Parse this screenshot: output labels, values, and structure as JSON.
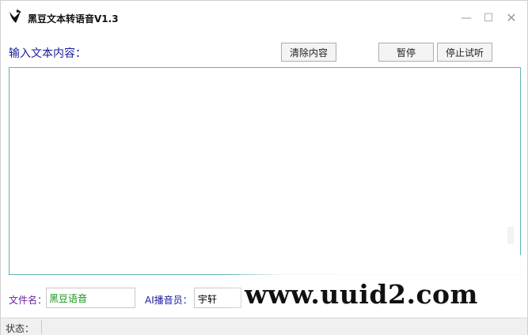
{
  "window": {
    "title": "黑豆文本转语音V1.3",
    "minimize_glyph": "—",
    "maximize_glyph": "☐",
    "close_glyph": "✕"
  },
  "editor": {
    "label": "输入文本内容：",
    "text": ""
  },
  "toolbar": {
    "clear_label": "清除内容",
    "pause_label": "暂停",
    "stop_label": "停止试听"
  },
  "options": {
    "filename_label": "文件名：",
    "filename_value": "黑豆语音",
    "announcer_label": "AI播音员：",
    "announcer_value": "宇轩"
  },
  "statusbar": {
    "label": "状态：",
    "value": ""
  },
  "watermark": {
    "text": "www.uuid2.com"
  },
  "icons": {
    "app": "bean-logo-icon"
  },
  "colors": {
    "label_blue": "#1a1aa0",
    "label_purple": "#6a1fa0",
    "filename_green": "#159615",
    "editor_border": "#5fb3b3"
  }
}
